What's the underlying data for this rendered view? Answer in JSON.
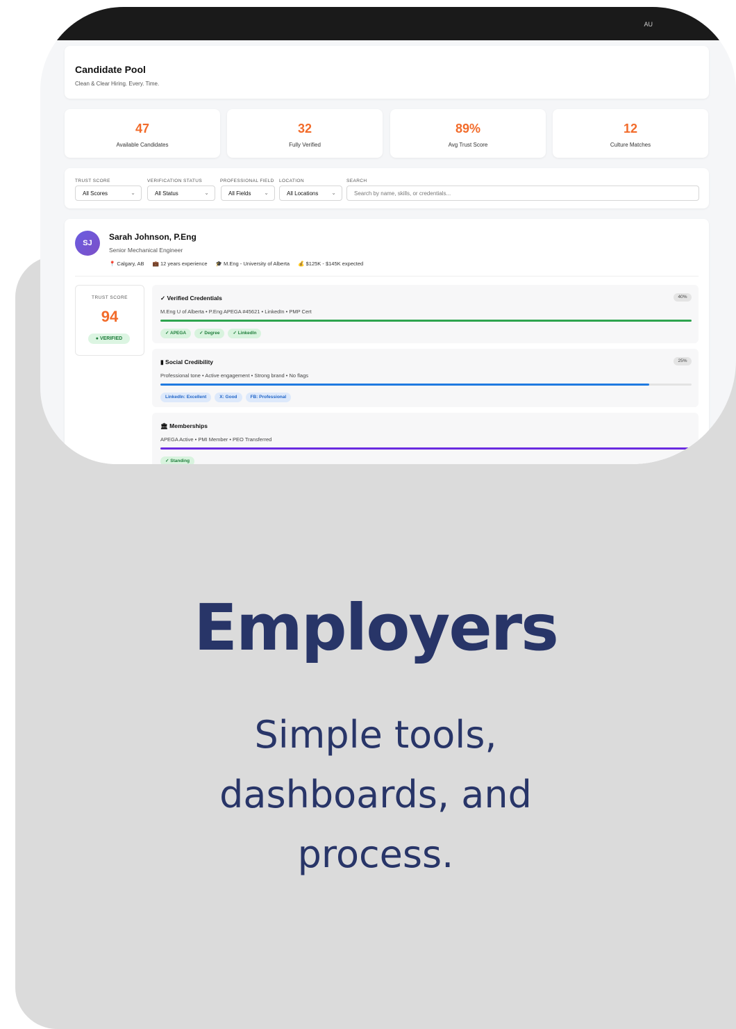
{
  "hero": {
    "title": "Employers",
    "subtitle_lines": [
      "Simple tools,",
      "dashboards, and",
      "process."
    ]
  },
  "topbar": {
    "text": "AU"
  },
  "header": {
    "title": "Candidate Pool",
    "tagline": "Clean & Clear Hiring. Every. Time."
  },
  "stats": [
    {
      "value": "47",
      "label": "Available Candidates"
    },
    {
      "value": "32",
      "label": "Fully Verified"
    },
    {
      "value": "89%",
      "label": "Avg Trust Score"
    },
    {
      "value": "12",
      "label": "Culture Matches"
    }
  ],
  "filters": {
    "trust_score": {
      "label": "TRUST SCORE",
      "value": "All Scores"
    },
    "verification_status": {
      "label": "VERIFICATION STATUS",
      "value": "All Status"
    },
    "professional_field": {
      "label": "PROFESSIONAL FIELD",
      "value": "All Fields"
    },
    "location": {
      "label": "LOCATION",
      "value": "All Locations"
    },
    "search": {
      "label": "SEARCH",
      "placeholder": "Search by name, skills, or credentials..."
    }
  },
  "candidate": {
    "initials": "SJ",
    "name": "Sarah Johnson, P.Eng",
    "role": "Senior Mechanical Engineer",
    "meta": {
      "location": "📍 Calgary, AB",
      "experience": "💼 12 years experience",
      "education": "🎓 M.Eng - University of Alberta",
      "salary": "💰 $125K - $145K expected"
    },
    "trust": {
      "label": "TRUST SCORE",
      "value": "94",
      "badge": "● VERIFIED"
    },
    "sections": [
      {
        "title": "✓ Verified Credentials",
        "percent_label": "40%",
        "description": "M.Eng U of Alberta • P.Eng APEGA #45621 • LinkedIn • PMP Cert",
        "progress": 1.0,
        "color": "#2ea44f",
        "tags": [
          "✓ APEGA",
          "✓ Degree",
          "✓ LinkedIn"
        ],
        "tag_style": "green"
      },
      {
        "title": "▮ Social Credibility",
        "percent_label": "25%",
        "description": "Professional tone • Active engagement • Strong brand • No flags",
        "progress": 0.92,
        "color": "#1f7ae0",
        "tags": [
          "LinkedIn: Excellent",
          "X: Good",
          "FB: Professional"
        ],
        "tag_style": "blue"
      },
      {
        "title": "🏛 Memberships",
        "percent_label": "",
        "description": "APEGA Active • PMI Member • PEO Transferred",
        "progress": 1.0,
        "color": "#6a2be0",
        "tags": [
          "✓ Standing"
        ],
        "tag_style": "green"
      }
    ]
  }
}
